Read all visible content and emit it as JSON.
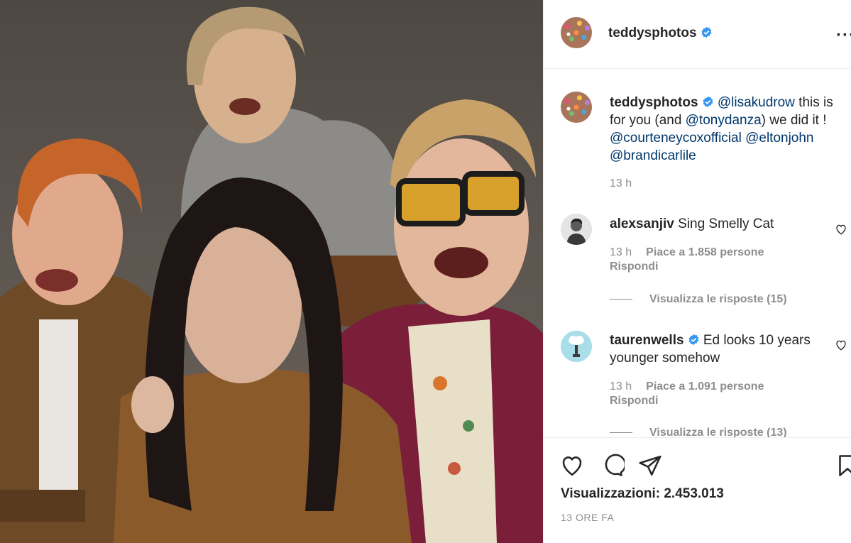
{
  "post": {
    "author": "teddysphotos",
    "caption_parts": [
      {
        "text": "@lisakudrow",
        "mention": true
      },
      {
        "text": " this is for you (and ",
        "mention": false
      },
      {
        "text": "@tonydanza",
        "mention": true
      },
      {
        "text": ") we did it ! ",
        "mention": false
      },
      {
        "text": "@courteneycoxofficial",
        "mention": true
      },
      {
        "text": " ",
        "mention": false
      },
      {
        "text": "@eltonjohn",
        "mention": true
      },
      {
        "text": " ",
        "mention": false
      },
      {
        "text": "@brandicarlile",
        "mention": true
      }
    ],
    "caption_time": "13 h",
    "views": "Visualizzazioni: 2.453.013",
    "posted_ago": "13 ORE FA"
  },
  "comments": [
    {
      "user": "alexsanjiv",
      "verified": false,
      "text": "Sing Smelly Cat",
      "time": "13 h",
      "likes": "Piace a 1.858 persone",
      "reply": "Rispondi",
      "view_replies": "Visualizza le risposte (15)"
    },
    {
      "user": "taurenwells",
      "verified": true,
      "text": "Ed looks 10 years younger somehow",
      "time": "13 h",
      "likes": "Piace a 1.091 persone",
      "reply": "Rispondi",
      "view_replies": "Visualizza le risposte (13)"
    }
  ],
  "icons": {
    "like": "heart-icon",
    "comment": "comment-icon",
    "share": "paper-plane-icon",
    "save": "bookmark-icon",
    "more": "more-options-icon",
    "verified": "verified-badge-icon"
  },
  "colors": {
    "mention": "#00376b",
    "verified": "#3897f0",
    "muted": "#8e8e8e",
    "text": "#262626"
  }
}
